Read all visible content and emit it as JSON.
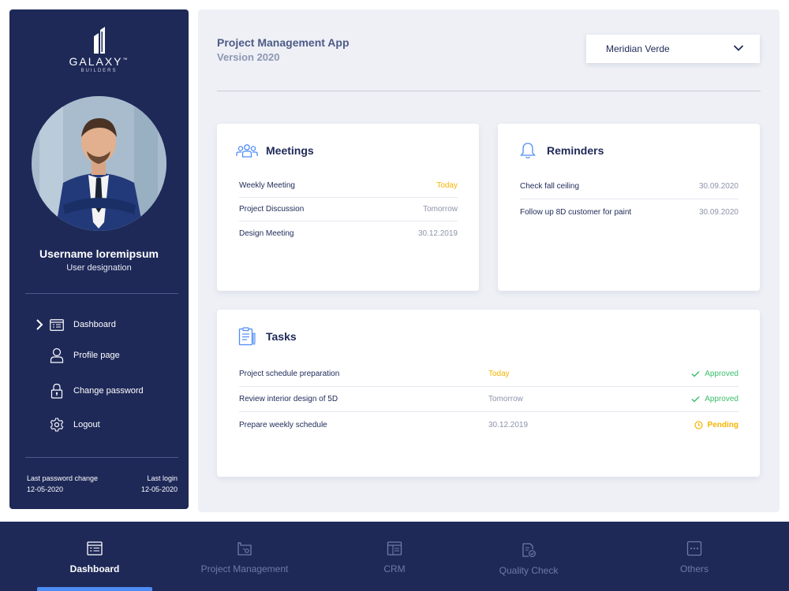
{
  "brand": {
    "name": "GALAXY",
    "tm": "™",
    "tagline": "BUILDERS"
  },
  "user": {
    "name": "Username loremipsum",
    "designation": "User designation"
  },
  "sidebar": {
    "items": [
      {
        "label": "Dashboard",
        "icon": "dashboard-icon"
      },
      {
        "label": "Profile page",
        "icon": "user-icon"
      },
      {
        "label": "Change password",
        "icon": "lock-icon"
      },
      {
        "label": "Logout",
        "icon": "gear-icon"
      }
    ],
    "last_password_change_label": "Last password change",
    "last_password_change": "12-05-2020",
    "last_login_label": "Last login",
    "last_login": "12-05-2020"
  },
  "header": {
    "title": "Project Management App",
    "version": "Version 2020",
    "selected_project": "Meridian Verde"
  },
  "meetings": {
    "title": "Meetings",
    "rows": [
      {
        "name": "Weekly Meeting",
        "when": "Today"
      },
      {
        "name": "Project Discussion",
        "when": "Tomorrow"
      },
      {
        "name": "Design Meeting",
        "when": "30.12.2019"
      }
    ]
  },
  "reminders": {
    "title": "Reminders",
    "rows": [
      {
        "name": "Check fall ceiling",
        "date": "30.09.2020"
      },
      {
        "name": "Follow up 8D customer for paint",
        "date": "30.09.2020"
      }
    ]
  },
  "tasks": {
    "title": "Tasks",
    "rows": [
      {
        "name": "Project schedule preparation",
        "due": "Today",
        "status": "Approved"
      },
      {
        "name": "Review interior design of 5D",
        "due": "Tomorrow",
        "status": "Approved"
      },
      {
        "name": "Prepare weekly schedule",
        "due": "30.12.2019",
        "status": "Pending"
      }
    ]
  },
  "bottom_nav": [
    {
      "label": "Dashboard",
      "icon": "dashboard-icon"
    },
    {
      "label": "Project Management",
      "icon": "blueprint-icon"
    },
    {
      "label": "CRM",
      "icon": "crm-icon"
    },
    {
      "label": "Quality Check",
      "icon": "quality-check-icon"
    },
    {
      "label": "Others",
      "icon": "more-icon"
    }
  ],
  "colors": {
    "navy": "#1e2958",
    "today": "#f5b400",
    "approved": "#3bbf6a",
    "pending": "#f5b400",
    "accent": "#4e8cf5"
  }
}
